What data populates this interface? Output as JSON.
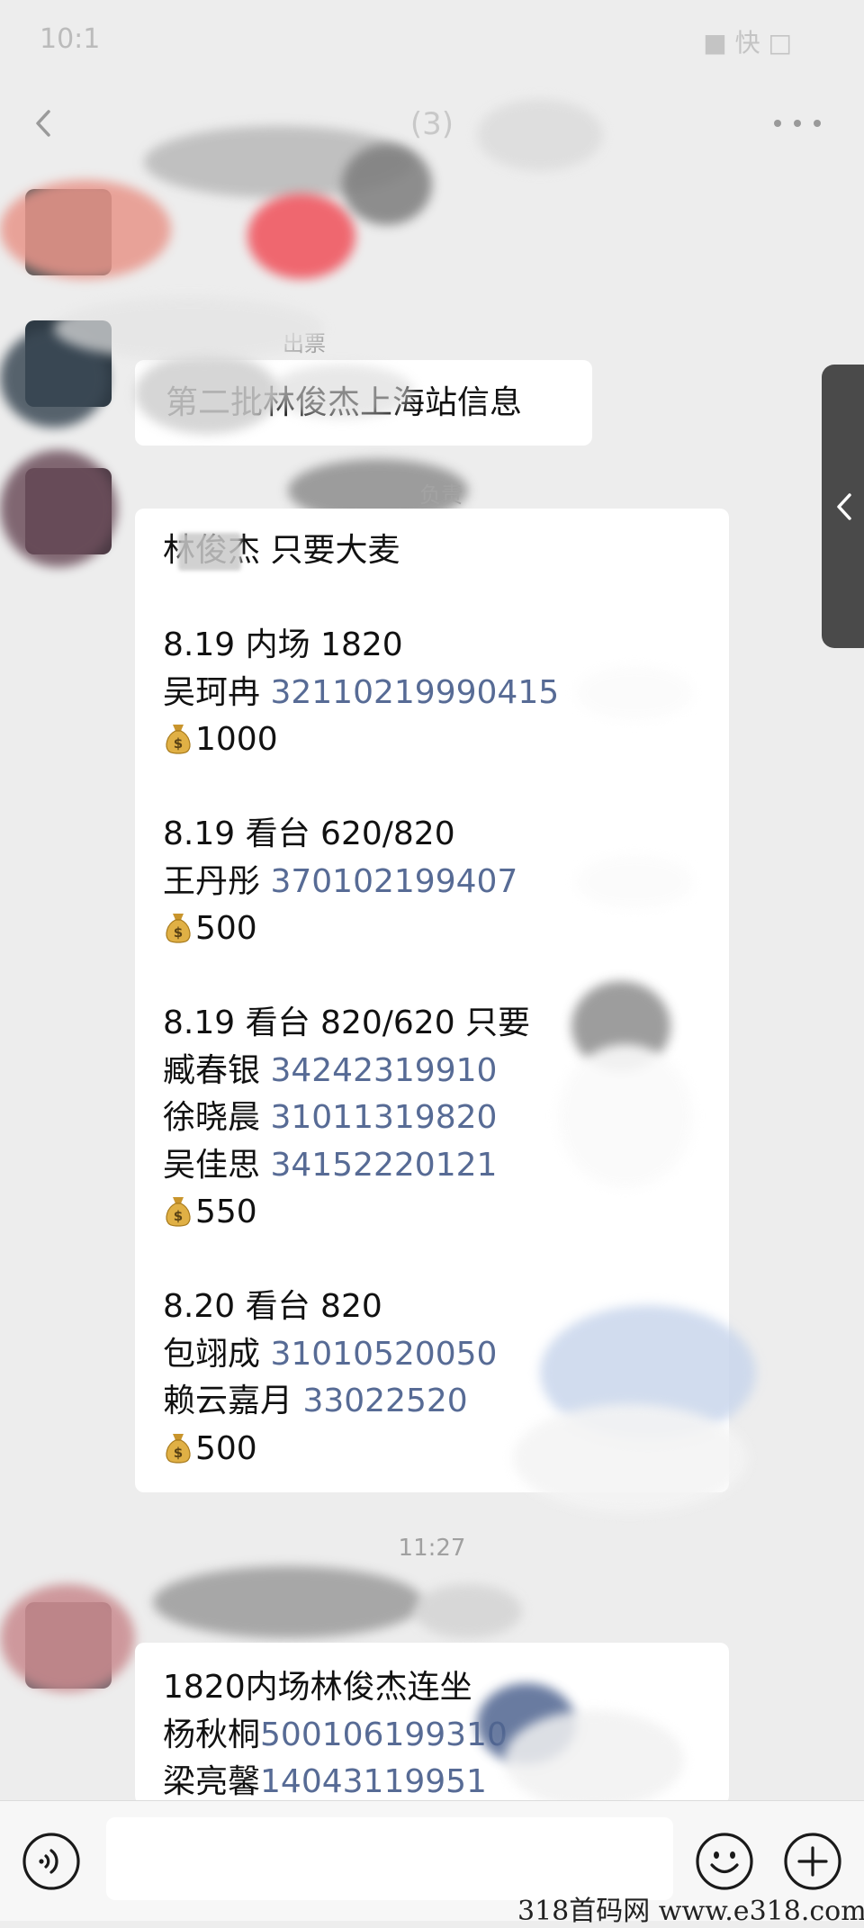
{
  "status_bar": {
    "time": "10:1",
    "right": "■ 快 □"
  },
  "header": {
    "title": "(3)"
  },
  "messages": {
    "first_bubble": "第二批林俊杰上海站信息",
    "sender_label_1": "出票",
    "sender_label_2": "负责",
    "second_bubble": {
      "lines": [
        "林俊杰 只要大麦",
        "",
        "8.19 内场 1820",
        {
          "name": "吴珂冉",
          "id": "32110219990415"
        },
        {
          "money": "1000"
        },
        "",
        "8.19 看台 620/820",
        {
          "name": "王丹彤",
          "id": "370102199407"
        },
        {
          "money": "500"
        },
        "",
        "8.19 看台 820/620  只要",
        {
          "name": "臧春银",
          "id": "34242319910"
        },
        {
          "name": "徐晓晨",
          "id": "31011319820"
        },
        {
          "name": "吴佳思",
          "id": "34152220121"
        },
        {
          "money": "550"
        },
        "",
        "8.20 看台 820",
        {
          "name": "包翊成",
          "id": "31010520050"
        },
        {
          "name": "赖云嘉月",
          "id": "33022520"
        },
        {
          "money": "500"
        }
      ]
    },
    "timestamp": "11:27",
    "third_bubble": {
      "lines": [
        "1820内场林俊杰连坐",
        {
          "name": "杨秋桐",
          "id": "500106199310"
        },
        {
          "name": "梁亮馨",
          "id": "14043119951"
        }
      ]
    }
  },
  "watermark": "318首码网  www.e318.com",
  "colors": {
    "background": "#ededed",
    "bubble": "#ffffff",
    "id_link": "#576b95",
    "side_handle": "#4a4a4a"
  },
  "icons": [
    "back-icon",
    "more-icon",
    "money-bag-icon",
    "voice-icon",
    "emoji-icon",
    "plus-icon",
    "chevron-left-icon"
  ]
}
